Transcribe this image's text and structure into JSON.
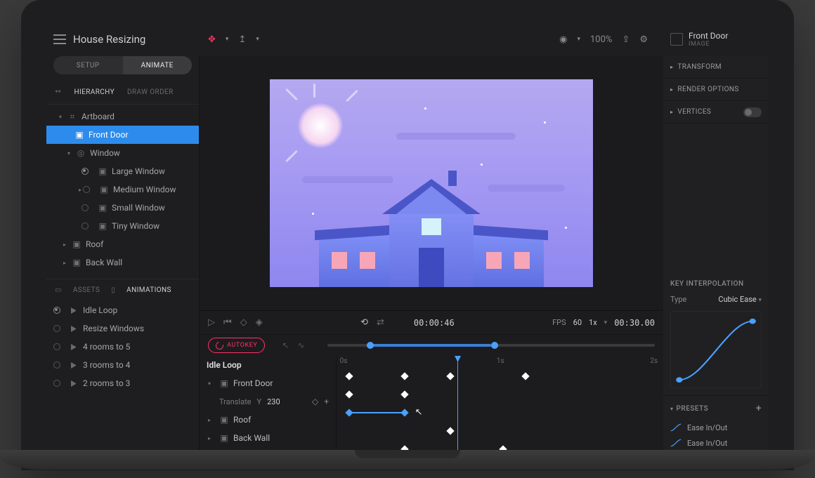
{
  "title": "House Resizing",
  "mode_tabs": {
    "setup": "SETUP",
    "animate": "ANIMATE",
    "active": "animate"
  },
  "hier_tabs": {
    "hierarchy": "HIERARCHY",
    "draworder": "DRAW ORDER"
  },
  "tree": {
    "root": "Artboard",
    "selected": "Front Door",
    "window": "Window",
    "window_children": [
      "Large Window",
      "Medium Window",
      "Small Window",
      "Tiny Window"
    ],
    "roof": "Roof",
    "backwall": "Back Wall"
  },
  "sub_tabs": {
    "assets": "ASSETS",
    "animations": "ANIMATIONS"
  },
  "animations": [
    "Idle Loop",
    "Resize Windows",
    "4 rooms to 5",
    "3 rooms to 4",
    "2 rooms to 3"
  ],
  "viewport": {
    "zoom": "100%"
  },
  "transport": {
    "time": "00:00:46",
    "fps_label": "FPS",
    "fps": "60",
    "rate": "1x",
    "duration": "00:30.00",
    "autokey": "AUTOKEY"
  },
  "ruler": {
    "t0": "0s",
    "t1": "1s",
    "t2": "2s"
  },
  "tl": {
    "name": "Idle Loop",
    "tracks": [
      {
        "name": "Front Door",
        "sub_label": "Translate",
        "axis": "Y",
        "value": "230"
      },
      {
        "name": "Roof"
      },
      {
        "name": "Back Wall"
      }
    ],
    "plus": "+"
  },
  "inspector": {
    "name": "Front Door",
    "type": "IMAGE",
    "sections": [
      "TRANSFORM",
      "RENDER OPTIONS",
      "VERTICES"
    ],
    "key_interp_title": "KEY INTERPOLATION",
    "type_label": "Type",
    "type_value": "Cubic Ease",
    "presets_title": "PRESETS",
    "presets": [
      "Ease In/Out",
      "Ease In/Out"
    ]
  }
}
